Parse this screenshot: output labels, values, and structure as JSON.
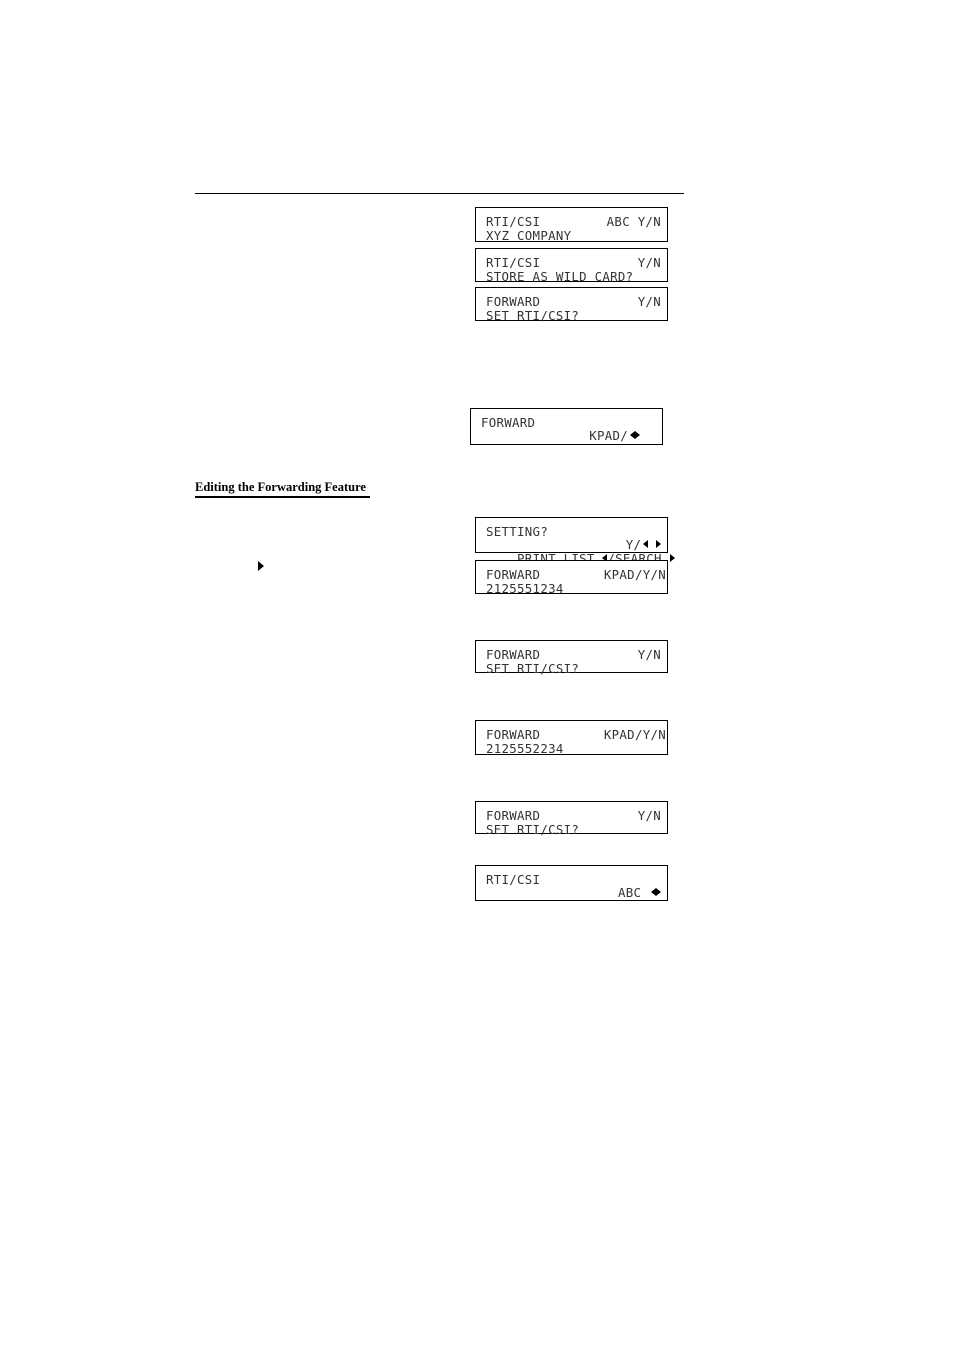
{
  "page": {
    "section_heading": "Editing the Forwarding Feature"
  },
  "panels": [
    {
      "line1_left": "RTI/CSI",
      "line1_right": "ABC Y/N",
      "line2": "XYZ COMPANY"
    },
    {
      "line1_left": "RTI/CSI",
      "line1_right": "Y/N",
      "line2": "STORE AS WILD CARD?"
    },
    {
      "line1_left": "FORWARD",
      "line1_right": "Y/N",
      "line2": "SET RTI/CSI?"
    },
    {
      "line1_left": "FORWARD",
      "line1_right": "KPAD/",
      "line1_icons": "left-right-arrows",
      "line2": ""
    },
    {
      "line1_left": "SETTING?",
      "line1_right": "Y/",
      "line1_icons": "left-right-arrows",
      "line2_a": "PRINT LIST ",
      "line2_b": "/SEARCH "
    },
    {
      "line1_left": "FORWARD",
      "line1_right": "KPAD/Y/N",
      "line2": "2125551234"
    },
    {
      "line1_left": "FORWARD",
      "line1_right": "Y/N",
      "line2": "SET RTI/CSI?"
    },
    {
      "line1_left": "FORWARD",
      "line1_right": "KPAD/Y/N",
      "line2": "2125552234"
    },
    {
      "line1_left": "FORWARD",
      "line1_right": "Y/N",
      "line2": "SET RTI/CSI?"
    },
    {
      "line1_left": "RTI/CSI",
      "line1_right": "ABC ",
      "line1_icons": "left-right-arrows",
      "line2": ""
    }
  ],
  "icons": {
    "step_marker": "right-triangle-icon",
    "lcd_arrows": "left-right-arrows-icon"
  }
}
